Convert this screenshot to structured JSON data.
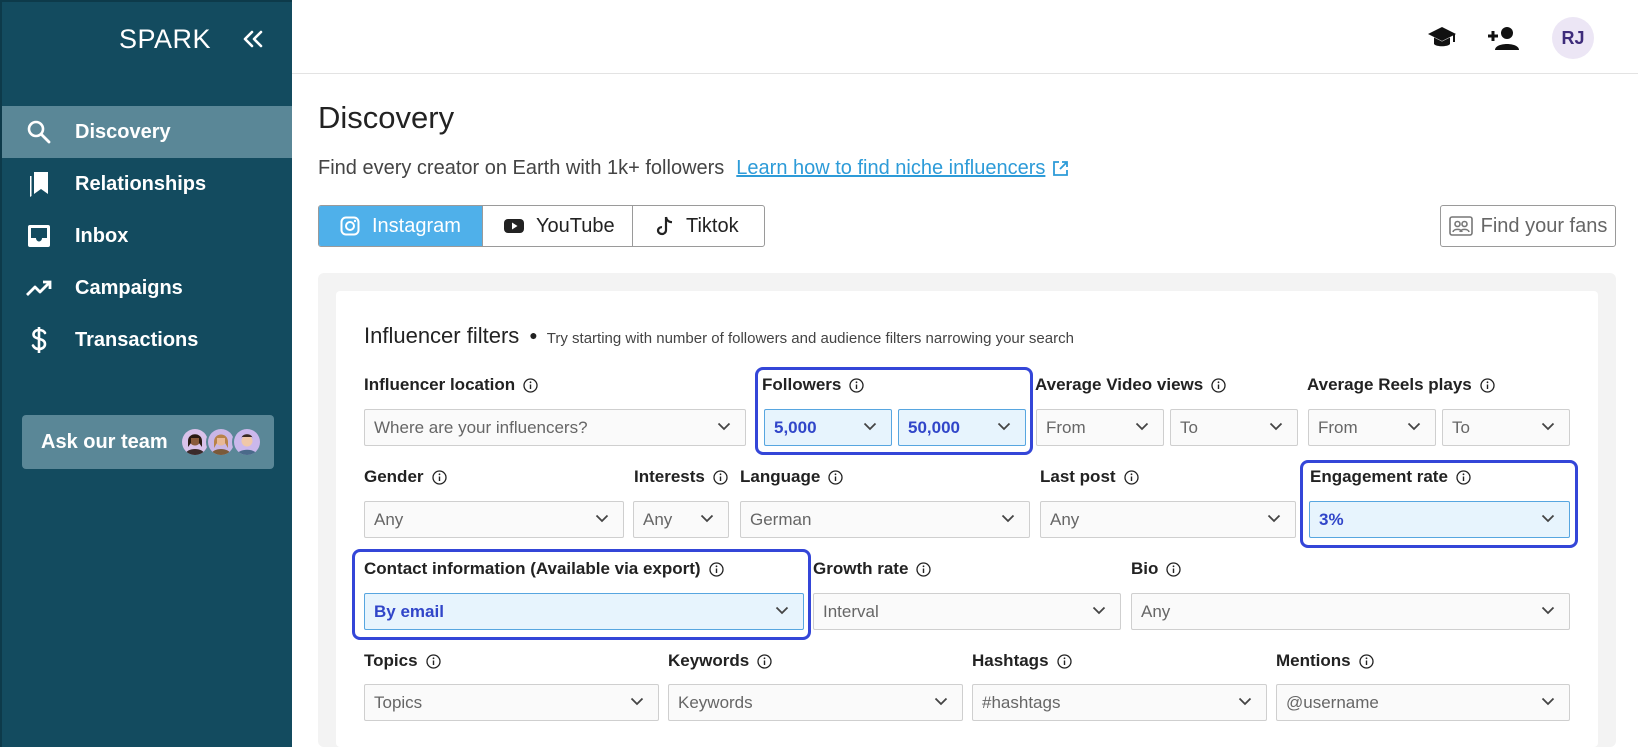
{
  "app": {
    "brand": "SPARK"
  },
  "sidebar": {
    "items": [
      {
        "label": "Discovery",
        "icon": "search-icon",
        "active": true
      },
      {
        "label": "Relationships",
        "icon": "bookmarks-icon"
      },
      {
        "label": "Inbox",
        "icon": "inbox-icon"
      },
      {
        "label": "Campaigns",
        "icon": "trending-up-icon"
      },
      {
        "label": "Transactions",
        "icon": "dollar-icon"
      }
    ],
    "ask_team": "Ask our team"
  },
  "header": {
    "user_initials": "RJ"
  },
  "page": {
    "title": "Discovery",
    "subtitle": "Find every creator on Earth with 1k+ followers",
    "learn_link": "Learn how to find niche influencers"
  },
  "tabs": [
    {
      "label": "Instagram",
      "active": true
    },
    {
      "label": "YouTube"
    },
    {
      "label": "Tiktok"
    }
  ],
  "find_fans": "Find your fans",
  "filters": {
    "title": "Influencer filters",
    "hint": "Try starting with number of followers and audience filters narrowing your search",
    "location": {
      "label": "Influencer location",
      "placeholder": "Where are your influencers?"
    },
    "followers": {
      "label": "Followers",
      "from": "5,000",
      "to": "50,000"
    },
    "avg_video_views": {
      "label": "Average Video views",
      "from": "From",
      "to": "To"
    },
    "avg_reels_plays": {
      "label": "Average Reels plays",
      "from": "From",
      "to": "To"
    },
    "gender": {
      "label": "Gender",
      "value": "Any"
    },
    "interests": {
      "label": "Interests",
      "value": "Any"
    },
    "language": {
      "label": "Language",
      "value": "German"
    },
    "last_post": {
      "label": "Last post",
      "value": "Any"
    },
    "engagement_rate": {
      "label": "Engagement rate",
      "value": "3%"
    },
    "contact_info": {
      "label": "Contact information (Available via export)",
      "value": "By email"
    },
    "growth_rate": {
      "label": "Growth rate",
      "value": "Interval"
    },
    "bio": {
      "label": "Bio",
      "value": "Any"
    },
    "topics": {
      "label": "Topics",
      "placeholder": "Topics"
    },
    "keywords": {
      "label": "Keywords",
      "placeholder": "Keywords"
    },
    "hashtags": {
      "label": "Hashtags",
      "placeholder": "#hashtags"
    },
    "mentions": {
      "label": "Mentions",
      "placeholder": "@username"
    }
  },
  "colors": {
    "sidebar_bg": "#134b5f",
    "sidebar_active": "#5a8797",
    "tab_active": "#4fb0ea",
    "link": "#2d9bd8",
    "highlight": "#3446d8",
    "filled_text": "#3146c9"
  }
}
